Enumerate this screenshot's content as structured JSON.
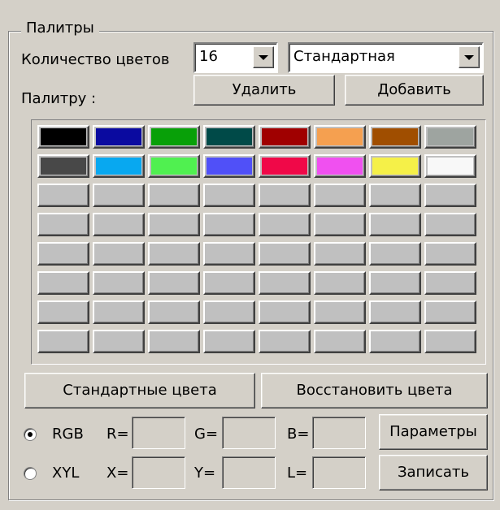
{
  "group": {
    "title": "Палитры"
  },
  "colors_count": {
    "label": "Количество цветов",
    "value": "16"
  },
  "palette_select": {
    "value": "Стандартная"
  },
  "palette_label": "Палитру :",
  "buttons": {
    "delete": "Удалить",
    "add": "Добавить",
    "standard_colors": "Стандартные цвета",
    "restore_colors": "Восстановить цвета",
    "parameters": "Параметры",
    "save": "Записать"
  },
  "palette": {
    "columns": 8,
    "rows": 8,
    "empty_color": "#c0c0c0",
    "colors": [
      "#000000",
      "#0a0aa0",
      "#08a008",
      "#004a48",
      "#a00000",
      "#f5a050",
      "#a04e00",
      "#9ea4a0",
      "#484848",
      "#08a8f0",
      "#50f050",
      "#5050f8",
      "#f00848",
      "#f050f0",
      "#f5f048",
      "#f8f8f8"
    ]
  },
  "color_model": {
    "selected": "RGB",
    "rgb": {
      "label": "RGB",
      "r": "R=",
      "g": "G=",
      "b": "B=",
      "r_value": "",
      "g_value": "",
      "b_value": ""
    },
    "xyl": {
      "label": "XYL",
      "x": "X=",
      "y": "Y=",
      "l": "L=",
      "x_value": "",
      "y_value": "",
      "l_value": ""
    }
  }
}
